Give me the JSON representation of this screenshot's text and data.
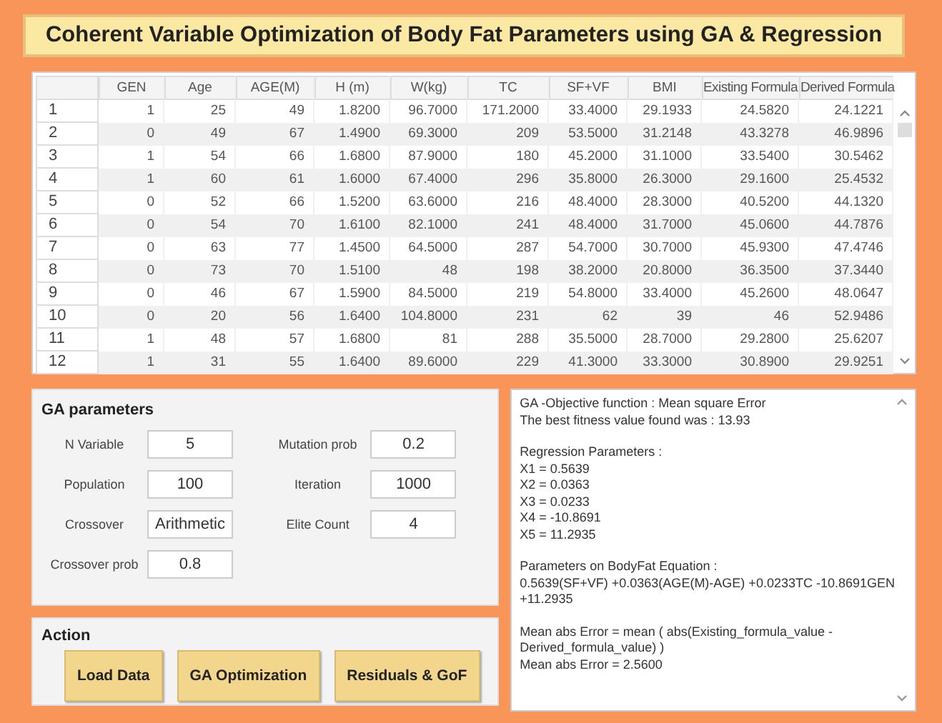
{
  "title": "Coherent Variable Optimization of Body Fat Parameters using GA & Regression",
  "table": {
    "columns": [
      "GEN",
      "Age",
      "AGE(M)",
      "H (m)",
      "W(kg)",
      "TC",
      "SF+VF",
      "BMI",
      "Existing Formula",
      "Derived Formula"
    ],
    "rows": [
      {
        "index": "1",
        "cells": [
          "1",
          "25",
          "49",
          "1.8200",
          "96.7000",
          "171.2000",
          "33.4000",
          "29.1933",
          "24.5820",
          "24.1221"
        ]
      },
      {
        "index": "2",
        "cells": [
          "0",
          "49",
          "67",
          "1.4900",
          "69.3000",
          "209",
          "53.5000",
          "31.2148",
          "43.3278",
          "46.9896"
        ]
      },
      {
        "index": "3",
        "cells": [
          "1",
          "54",
          "66",
          "1.6800",
          "87.9000",
          "180",
          "45.2000",
          "31.1000",
          "33.5400",
          "30.5462"
        ]
      },
      {
        "index": "4",
        "cells": [
          "1",
          "60",
          "61",
          "1.6000",
          "67.4000",
          "296",
          "35.8000",
          "26.3000",
          "29.1600",
          "25.4532"
        ]
      },
      {
        "index": "5",
        "cells": [
          "0",
          "52",
          "66",
          "1.5200",
          "63.6000",
          "216",
          "48.4000",
          "28.3000",
          "40.5200",
          "44.1320"
        ]
      },
      {
        "index": "6",
        "cells": [
          "0",
          "54",
          "70",
          "1.6100",
          "82.1000",
          "241",
          "48.4000",
          "31.7000",
          "45.0600",
          "44.7876"
        ]
      },
      {
        "index": "7",
        "cells": [
          "0",
          "63",
          "77",
          "1.4500",
          "64.5000",
          "287",
          "54.7000",
          "30.7000",
          "45.9300",
          "47.4746"
        ]
      },
      {
        "index": "8",
        "cells": [
          "0",
          "73",
          "70",
          "1.5100",
          "48",
          "198",
          "38.2000",
          "20.8000",
          "36.3500",
          "37.3440"
        ]
      },
      {
        "index": "9",
        "cells": [
          "0",
          "46",
          "67",
          "1.5900",
          "84.5000",
          "219",
          "54.8000",
          "33.4000",
          "45.2600",
          "48.0647"
        ]
      },
      {
        "index": "10",
        "cells": [
          "0",
          "20",
          "56",
          "1.6400",
          "104.8000",
          "231",
          "62",
          "39",
          "46",
          "52.9486"
        ]
      },
      {
        "index": "11",
        "cells": [
          "1",
          "48",
          "57",
          "1.6800",
          "81",
          "288",
          "35.5000",
          "28.7000",
          "29.2800",
          "25.6207"
        ]
      },
      {
        "index": "12",
        "cells": [
          "1",
          "31",
          "55",
          "1.6400",
          "89.6000",
          "229",
          "41.3000",
          "33.3000",
          "30.8900",
          "29.9251"
        ]
      }
    ]
  },
  "ga_parameters": {
    "title": "GA parameters",
    "fields": [
      {
        "label": "N Variable",
        "value": "5"
      },
      {
        "label": "Mutation prob",
        "value": "0.2"
      },
      {
        "label": "Population",
        "value": "100"
      },
      {
        "label": "Iteration",
        "value": "1000"
      },
      {
        "label": "Crossover",
        "value": "Arithmetic"
      },
      {
        "label": "Elite Count",
        "value": "4"
      },
      {
        "label": "Crossover prob",
        "value": "0.8"
      }
    ]
  },
  "action": {
    "title": "Action",
    "buttons": [
      "Load Data",
      "GA Optimization",
      "Residuals & GoF"
    ]
  },
  "output": {
    "paragraphs": [
      [
        "GA -Objective function : Mean square Error",
        "The best fitness value found was : 13.93"
      ],
      [
        "Regression Parameters :",
        "X1 = 0.5639",
        "X2 = 0.0363",
        "X3 = 0.0233",
        "X4 = -10.8691",
        "X5 = 11.2935"
      ],
      [
        "Parameters on BodyFat Equation :",
        "0.5639(SF+VF)   +0.0363(AGE(M)-AGE)  +0.0233TC  -10.8691GEN",
        "+11.2935"
      ],
      [
        "Mean abs Error  = mean ( abs(Existing_formula_value -",
        "Derived_formula_value) )",
        "Mean abs Error  = 2.5600"
      ]
    ]
  }
}
